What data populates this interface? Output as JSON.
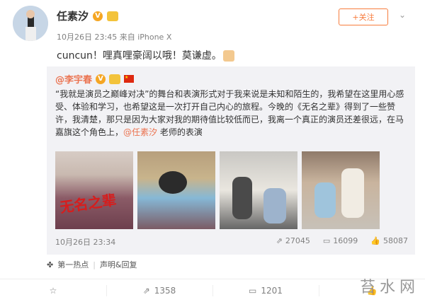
{
  "user": {
    "name": "任素汐",
    "date": "10月26日 23:45",
    "source": "来自 iPhone X"
  },
  "follow_label": "+关注",
  "post_text": "cuncun！哩真哩豪阔以哦！莫谦虚。",
  "repost": {
    "user": "@李宇春",
    "text_parts": [
      "“我就是演员之巅峰对决”的舞台和表演形式对于我来说是未知和陌生的，我希望在这里用心感受、体验和学习，也希望这是一次打开自己内心的旅程。今晚的《无名之辈》得到了一些赞许，我清楚，那只是因为大家对我的期待值比较低而已，我离一个真正的演员还差很远，在马嘉旗这个角色上，",
      "@任素汐",
      " 老师的表演"
    ],
    "image_title": "无名之辈",
    "date": "10月26日 23:34",
    "stats": {
      "reposts": "27045",
      "comments": "16099",
      "likes": "58087"
    }
  },
  "hot": {
    "label": "第一热点",
    "statement": "声明&回复"
  },
  "actions": {
    "reposts": "1358",
    "comments": "1201"
  },
  "watermark": "苔水网"
}
